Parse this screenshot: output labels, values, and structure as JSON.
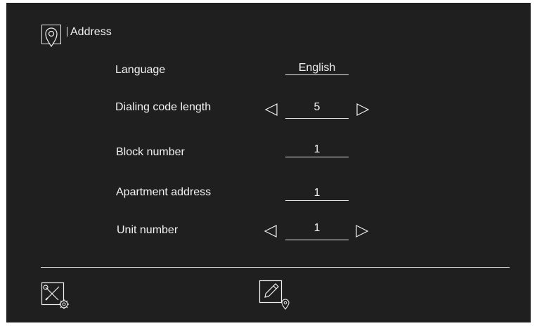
{
  "header": {
    "title": "Address",
    "icon": "location-pin-icon"
  },
  "settings": [
    {
      "label": "Language",
      "value": "English"
    },
    {
      "label": "Dialing code length",
      "value": "5"
    },
    {
      "label": "Block number",
      "value": "1"
    },
    {
      "label": "Apartment address",
      "value": "1"
    },
    {
      "label": "Unit number",
      "value": "1"
    }
  ],
  "footer": {
    "left_icon": "settings-tools-icon",
    "right_icon": "edit-address-icon"
  },
  "colors": {
    "background": "#1f1f1f",
    "foreground": "#f2f2f2"
  }
}
